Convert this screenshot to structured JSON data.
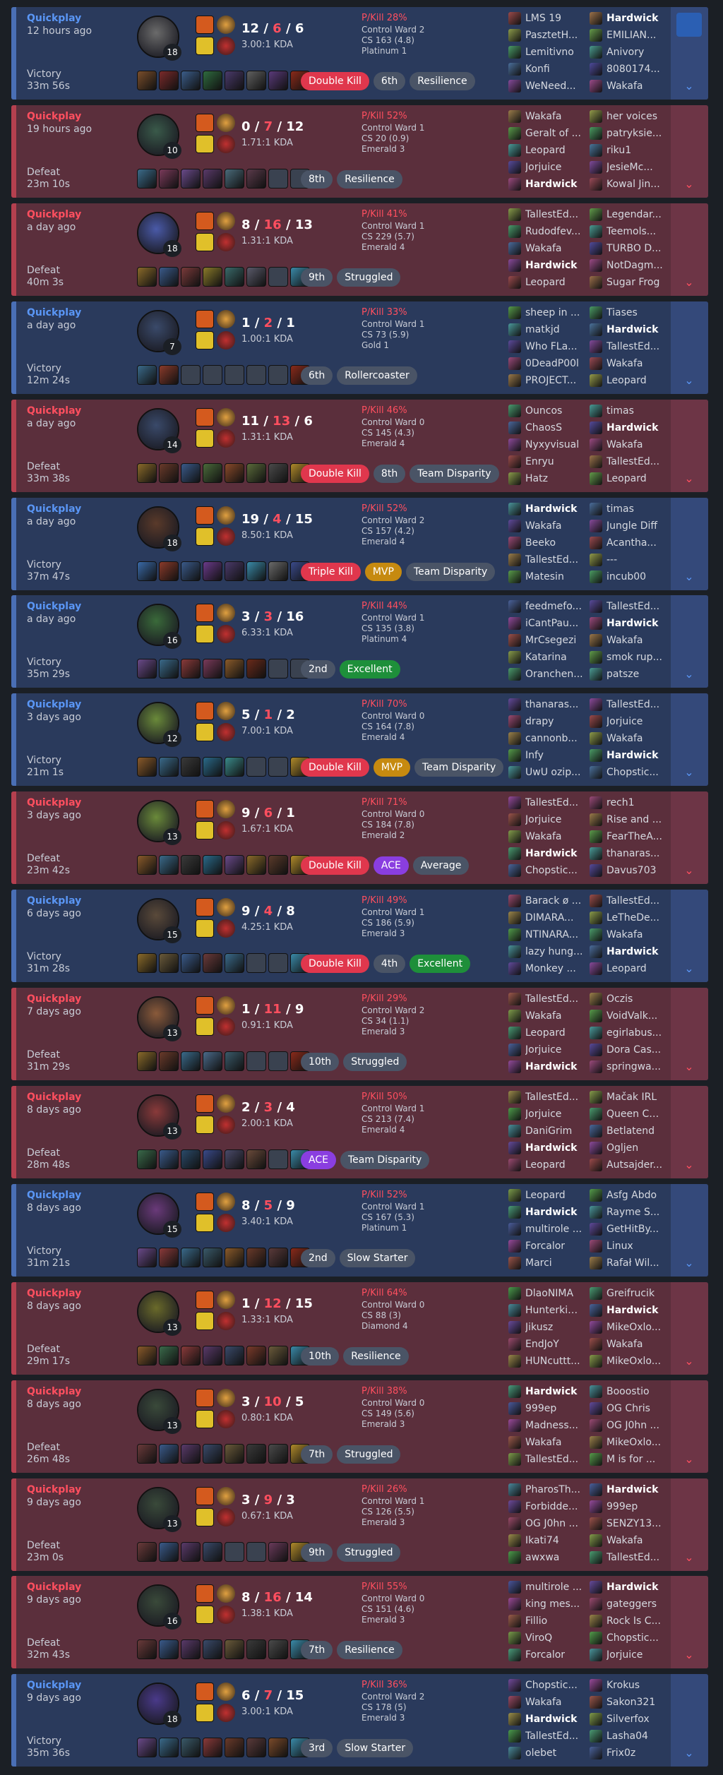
{
  "matches": [
    {
      "result_class": "win",
      "mode": "Quickplay",
      "ago": "12 hours ago",
      "result": "Victory",
      "duration": "33m 56s",
      "level": "18",
      "k": "12",
      "d": "6",
      "a": "6",
      "kda": "3.00:1 KDA",
      "pkill": "P/Kill 28%",
      "ward": "Control Ward 2",
      "cs": "CS 163 (4.8)",
      "rank": "Platinum 1",
      "badges": [
        {
          "t": "Double Kill",
          "c": "b-red"
        },
        {
          "t": "6th",
          "c": "b-gray"
        },
        {
          "t": "Resilience",
          "c": "b-gray"
        }
      ],
      "team1": [
        "LMS 19",
        "PasztetH...",
        "Lemitivno",
        "Konfi",
        "WeNeed..."
      ],
      "team2": [
        "Hardwick",
        "EMILIAN...",
        "Anivory",
        "8080174...",
        "Wakafa"
      ],
      "me_team": 2,
      "me_idx": 0,
      "champ_color": "#6b6b6b",
      "items": [
        "#7a4e2b",
        "#7a2a2a",
        "#3b5d8a",
        "#2f6b3f",
        "#4a3a6b",
        "#606060",
        "#5a3a7a",
        "#8a2a1a"
      ],
      "video": true
    },
    {
      "result_class": "loss",
      "mode": "Quickplay",
      "ago": "19 hours ago",
      "result": "Defeat",
      "duration": "23m 10s",
      "level": "10",
      "k": "0",
      "d": "7",
      "a": "12",
      "kda": "1.71:1 KDA",
      "pkill": "P/Kill 52%",
      "ward": "Control Ward 1",
      "cs": "CS 20 (0.9)",
      "rank": "Emerald 3",
      "badges": [
        {
          "t": "8th",
          "c": "b-gray"
        },
        {
          "t": "Resilience",
          "c": "b-gray"
        }
      ],
      "team1": [
        "Wakafa",
        "Geralt of ...",
        "Leopard",
        "Jorjuice",
        "Hardwick"
      ],
      "team2": [
        "her voices",
        "patryksie...",
        "riku1",
        "JesieMc...",
        "Kowal Jin..."
      ],
      "me_team": 1,
      "me_idx": 4,
      "champ_color": "#3a5a4a",
      "items": [
        "#3b6b8a",
        "#7a3a5a",
        "#6a4a8a",
        "#5a3a6a",
        "#4a6b7a",
        "#5a3a4a",
        "",
        ""
      ]
    },
    {
      "result_class": "loss",
      "mode": "Quickplay",
      "ago": "a day ago",
      "result": "Defeat",
      "duration": "40m 3s",
      "level": "18",
      "k": "8",
      "d": "16",
      "a": "13",
      "kda": "1.31:1 KDA",
      "pkill": "P/Kill 41%",
      "ward": "Control Ward 1",
      "cs": "CS 229 (5.7)",
      "rank": "Emerald 4",
      "badges": [
        {
          "t": "9th",
          "c": "b-gray"
        },
        {
          "t": "Struggled",
          "c": "b-gray"
        }
      ],
      "team1": [
        "TallestEd...",
        "Rudodfev...",
        "Wakafa",
        "Hardwick",
        "Leopard"
      ],
      "team2": [
        "Legendar...",
        "Teemols...",
        "TURBO D...",
        "NotDagm...",
        "Sugar Frog"
      ],
      "me_team": 1,
      "me_idx": 3,
      "champ_color": "#4a5aa8",
      "items": [
        "#8a6a2a",
        "#3a5a8a",
        "#7a3a3a",
        "#8a7a2a",
        "#3a6a6a",
        "#5a5a6a",
        "",
        "#3a8aa8"
      ]
    },
    {
      "result_class": "win",
      "mode": "Quickplay",
      "ago": "a day ago",
      "result": "Victory",
      "duration": "12m 24s",
      "level": "7",
      "k": "1",
      "d": "2",
      "a": "1",
      "kda": "1.00:1 KDA",
      "pkill": "P/Kill 33%",
      "ward": "Control Ward 1",
      "cs": "CS 73 (5.9)",
      "rank": "Gold 1",
      "badges": [
        {
          "t": "6th",
          "c": "b-gray"
        },
        {
          "t": "Rollercoaster",
          "c": "b-gray"
        }
      ],
      "team1": [
        "sheep in ...",
        "matkjd",
        "Who FLa...",
        "0DeadP00l",
        "PROJECT..."
      ],
      "team2": [
        "Tiases",
        "Hardwick",
        "TallestEd...",
        "Wakafa",
        "Leopard"
      ],
      "me_team": 2,
      "me_idx": 1,
      "champ_color": "#3a4a6a",
      "items": [
        "#3a6a8a",
        "#8a3a2a",
        "",
        "",
        "",
        "",
        "",
        "#8a2a1a"
      ]
    },
    {
      "result_class": "loss",
      "mode": "Quickplay",
      "ago": "a day ago",
      "result": "Defeat",
      "duration": "33m 38s",
      "level": "14",
      "k": "11",
      "d": "13",
      "a": "6",
      "kda": "1.31:1 KDA",
      "pkill": "P/Kill 46%",
      "ward": "Control Ward 0",
      "cs": "CS 145 (4.3)",
      "rank": "Emerald 4",
      "badges": [
        {
          "t": "Double Kill",
          "c": "b-red"
        },
        {
          "t": "8th",
          "c": "b-gray"
        },
        {
          "t": "Team Disparity",
          "c": "b-gray"
        }
      ],
      "team1": [
        "Ouncos",
        "ChaosS",
        "Nyxyvisual",
        "Enryu",
        "Hatz"
      ],
      "team2": [
        "timas",
        "Hardwick",
        "Wakafa",
        "TallestEd...",
        "Leopard"
      ],
      "me_team": 2,
      "me_idx": 1,
      "champ_color": "#3a4a6a",
      "items": [
        "#8a6a2a",
        "#6a3a2a",
        "#3a5a8a",
        "#4a6a3a",
        "#8a4a2a",
        "#5a6a3a",
        "#4a4a4a",
        "#b08a2a"
      ]
    },
    {
      "result_class": "win",
      "mode": "Quickplay",
      "ago": "a day ago",
      "result": "Victory",
      "duration": "37m 47s",
      "level": "18",
      "k": "19",
      "d": "4",
      "a": "15",
      "kda": "8.50:1 KDA",
      "pkill": "P/Kill 52%",
      "ward": "Control Ward 2",
      "cs": "CS 157 (4.2)",
      "rank": "Emerald 4",
      "badges": [
        {
          "t": "Triple Kill",
          "c": "b-red"
        },
        {
          "t": "MVP",
          "c": "b-gold"
        },
        {
          "t": "Team Disparity",
          "c": "b-gray"
        }
      ],
      "team1": [
        "Hardwick",
        "Wakafa",
        "Beeko",
        "TallestEd...",
        "Matesin"
      ],
      "team2": [
        "timas",
        "Jungle Diff",
        "Acantha...",
        "---",
        "incub00"
      ],
      "me_team": 1,
      "me_idx": 0,
      "champ_color": "#5a3a2a",
      "items": [
        "#3a6aa8",
        "#8a3a2a",
        "#3a5a8a",
        "#6a3a8a",
        "#4a3a6a",
        "#3a8aa8",
        "#6a6a6a",
        "#3a4a8a"
      ]
    },
    {
      "result_class": "win",
      "mode": "Quickplay",
      "ago": "a day ago",
      "result": "Victory",
      "duration": "35m 29s",
      "level": "16",
      "k": "3",
      "d": "3",
      "a": "16",
      "kda": "6.33:1 KDA",
      "pkill": "P/Kill 44%",
      "ward": "Control Ward 1",
      "cs": "CS 135 (3.8)",
      "rank": "Platinum 4",
      "badges": [
        {
          "t": "2nd",
          "c": "b-gray"
        },
        {
          "t": "Excellent",
          "c": "b-green"
        }
      ],
      "team1": [
        "feedmefo...",
        "iCantPau...",
        "MrCsegezi",
        "Katarina",
        "Oranchen..."
      ],
      "team2": [
        "TallestEd...",
        "Hardwick",
        "Wakafa",
        "smok rup...",
        "patsze"
      ],
      "me_team": 2,
      "me_idx": 1,
      "champ_color": "#3a6a3a",
      "items": [
        "#6a4a8a",
        "#3a6a8a",
        "#8a3a3a",
        "#7a3a5a",
        "#8a5a2a",
        "#6a2a1a",
        "",
        ""
      ]
    },
    {
      "result_class": "win",
      "mode": "Quickplay",
      "ago": "3 days ago",
      "result": "Victory",
      "duration": "21m 1s",
      "level": "12",
      "k": "5",
      "d": "1",
      "a": "2",
      "kda": "7.00:1 KDA",
      "pkill": "P/Kill 70%",
      "ward": "Control Ward 0",
      "cs": "CS 164 (7.8)",
      "rank": "Emerald 4",
      "badges": [
        {
          "t": "Double Kill",
          "c": "b-red"
        },
        {
          "t": "MVP",
          "c": "b-gold"
        },
        {
          "t": "Team Disparity",
          "c": "b-gray"
        }
      ],
      "team1": [
        "thanaras...",
        "drapy",
        "cannonb...",
        "Infy",
        "UwU ozip..."
      ],
      "team2": [
        "TallestEd...",
        "Jorjuice",
        "Wakafa",
        "Hardwick",
        "Chopstic..."
      ],
      "me_team": 2,
      "me_idx": 3,
      "champ_color": "#6a8a3a",
      "items": [
        "#8a5a2a",
        "#3a6a8a",
        "#3a3a3a",
        "#2a6a8a",
        "#3a8a8a",
        "",
        "",
        "#b08a2a"
      ]
    },
    {
      "result_class": "loss",
      "mode": "Quickplay",
      "ago": "3 days ago",
      "result": "Defeat",
      "duration": "23m 42s",
      "level": "13",
      "k": "9",
      "d": "6",
      "a": "1",
      "kda": "1.67:1 KDA",
      "pkill": "P/Kill 71%",
      "ward": "Control Ward 0",
      "cs": "CS 184 (7.8)",
      "rank": "Emerald 2",
      "badges": [
        {
          "t": "Double Kill",
          "c": "b-red"
        },
        {
          "t": "ACE",
          "c": "b-purple"
        },
        {
          "t": "Average",
          "c": "b-gray"
        }
      ],
      "team1": [
        "TallestEd...",
        "Jorjuice",
        "Wakafa",
        "Hardwick",
        "Chopstic..."
      ],
      "team2": [
        "rech1",
        "Rise and ...",
        "FearTheA...",
        "thanaras...",
        "Davus703"
      ],
      "me_team": 1,
      "me_idx": 3,
      "champ_color": "#6a8a3a",
      "items": [
        "#8a5a2a",
        "#3a6a8a",
        "#3a3a3a",
        "#2a6a8a",
        "#6a4a8a",
        "#8a6a2a",
        "#5a3a2a",
        "#b08a2a"
      ]
    },
    {
      "result_class": "win",
      "mode": "Quickplay",
      "ago": "6 days ago",
      "result": "Victory",
      "duration": "31m 28s",
      "level": "15",
      "k": "9",
      "d": "4",
      "a": "8",
      "kda": "4.25:1 KDA",
      "pkill": "P/Kill 49%",
      "ward": "Control Ward 1",
      "cs": "CS 186 (5.9)",
      "rank": "Emerald 3",
      "badges": [
        {
          "t": "Double Kill",
          "c": "b-red"
        },
        {
          "t": "4th",
          "c": "b-gray"
        },
        {
          "t": "Excellent",
          "c": "b-green"
        }
      ],
      "team1": [
        "Barack ø ...",
        "DIMARA...",
        "NTINARA...",
        "lazy hung...",
        "Monkey ..."
      ],
      "team2": [
        "TallestEd...",
        "LeTheDe...",
        "Wakafa",
        "Hardwick",
        "Leopard"
      ],
      "me_team": 2,
      "me_idx": 3,
      "champ_color": "#5a4a3a",
      "items": [
        "#8a6a2a",
        "#6a5a3a",
        "#3a5a8a",
        "#6a3a3a",
        "#3a6a8a",
        "",
        "",
        "#3a8aa8"
      ]
    },
    {
      "result_class": "loss",
      "mode": "Quickplay",
      "ago": "7 days ago",
      "result": "Defeat",
      "duration": "31m 29s",
      "level": "13",
      "k": "1",
      "d": "11",
      "a": "9",
      "kda": "0.91:1 KDA",
      "pkill": "P/Kill 29%",
      "ward": "Control Ward 2",
      "cs": "CS 34 (1.1)",
      "rank": "Emerald 3",
      "badges": [
        {
          "t": "10th",
          "c": "b-gray"
        },
        {
          "t": "Struggled",
          "c": "b-gray"
        }
      ],
      "team1": [
        "TallestEd...",
        "Wakafa",
        "Leopard",
        "Jorjuice",
        "Hardwick"
      ],
      "team2": [
        "Oczis",
        "VoidValk...",
        "egirlabus...",
        "Dora Cas...",
        "springwa..."
      ],
      "me_team": 1,
      "me_idx": 4,
      "champ_color": "#8a5a3a",
      "items": [
        "#8a6a2a",
        "#6a3a2a",
        "#3a6a8a",
        "#4a6a8a",
        "#3a5a6a",
        "",
        "",
        "#8a2a1a"
      ]
    },
    {
      "result_class": "loss",
      "mode": "Quickplay",
      "ago": "8 days ago",
      "result": "Defeat",
      "duration": "28m 48s",
      "level": "13",
      "k": "2",
      "d": "3",
      "a": "4",
      "kda": "2.00:1 KDA",
      "pkill": "P/Kill 50%",
      "ward": "Control Ward 1",
      "cs": "CS 213 (7.4)",
      "rank": "Emerald 4",
      "badges": [
        {
          "t": "ACE",
          "c": "b-purple"
        },
        {
          "t": "Team Disparity",
          "c": "b-gray"
        }
      ],
      "team1": [
        "TallestEd...",
        "Jorjuice",
        "DaniGrim",
        "Hardwick",
        "Leopard"
      ],
      "team2": [
        "Mačak IRL",
        "Queen Ca...",
        "Betlatend",
        "Ogljen",
        "Autsajder..."
      ],
      "me_team": 1,
      "me_idx": 3,
      "champ_color": "#8a3a3a",
      "items": [
        "#3a6a4a",
        "#3a5a8a",
        "#2a4a6a",
        "#3a4a8a",
        "#4a4a6a",
        "#6a4a3a",
        "",
        "#3a8aa8"
      ]
    },
    {
      "result_class": "win",
      "mode": "Quickplay",
      "ago": "8 days ago",
      "result": "Victory",
      "duration": "31m 21s",
      "level": "15",
      "k": "8",
      "d": "5",
      "a": "9",
      "kda": "3.40:1 KDA",
      "pkill": "P/Kill 52%",
      "ward": "Control Ward 1",
      "cs": "CS 167 (5.3)",
      "rank": "Platinum 1",
      "badges": [
        {
          "t": "2nd",
          "c": "b-gray"
        },
        {
          "t": "Slow Starter",
          "c": "b-gray"
        }
      ],
      "team1": [
        "Leopard",
        "Hardwick",
        "multirole ...",
        "Forcalor",
        "Marci"
      ],
      "team2": [
        "Asfg Abdo",
        "Rayme S...",
        "GetHitBy...",
        "Linux",
        "Rafał Wil..."
      ],
      "me_team": 1,
      "me_idx": 1,
      "champ_color": "#6a3a7a",
      "items": [
        "#6a4a8a",
        "#8a3a3a",
        "#3a6a8a",
        "#3a5a6a",
        "#8a5a2a",
        "#6a3a2a",
        "#5a3a3a",
        "#8a2a1a"
      ]
    },
    {
      "result_class": "loss",
      "mode": "Quickplay",
      "ago": "8 days ago",
      "result": "Defeat",
      "duration": "29m 17s",
      "level": "13",
      "k": "1",
      "d": "12",
      "a": "15",
      "kda": "1.33:1 KDA",
      "pkill": "P/Kill 64%",
      "ward": "Control Ward 0",
      "cs": "CS 88 (3)",
      "rank": "Diamond 4",
      "badges": [
        {
          "t": "10th",
          "c": "b-gray"
        },
        {
          "t": "Resilience",
          "c": "b-gray"
        }
      ],
      "team1": [
        "DlaoNIMA",
        "Hunterkin...",
        "Jikusz",
        "EndJoY",
        "HUNcuttt..."
      ],
      "team2": [
        "Greifrucik",
        "Hardwick",
        "MikeOxlo...",
        "Wakafa",
        "MikeOxlo..."
      ],
      "me_team": 2,
      "me_idx": 1,
      "champ_color": "#6a6a2a",
      "items": [
        "#8a5a2a",
        "#3a6a4a",
        "#8a3a3a",
        "#5a3a6a",
        "#3a4a6a",
        "#7a3a2a",
        "#6a5a3a",
        "#3a8aa8"
      ]
    },
    {
      "result_class": "loss",
      "mode": "Quickplay",
      "ago": "8 days ago",
      "result": "Defeat",
      "duration": "26m 48s",
      "level": "13",
      "k": "3",
      "d": "10",
      "a": "5",
      "kda": "0.80:1 KDA",
      "pkill": "P/Kill 38%",
      "ward": "Control Ward 0",
      "cs": "CS 149 (5.6)",
      "rank": "Emerald 3",
      "badges": [
        {
          "t": "7th",
          "c": "b-gray"
        },
        {
          "t": "Struggled",
          "c": "b-gray"
        }
      ],
      "team1": [
        "Hardwick",
        "999ep",
        "Madness...",
        "Wakafa",
        "TallestEd..."
      ],
      "team2": [
        "Booostio",
        "OG Chris",
        "OG J0hn ...",
        "MikeOxlo...",
        "M is for ..."
      ],
      "me_team": 1,
      "me_idx": 0,
      "champ_color": "#3a4a3a",
      "items": [
        "#6a3a3a",
        "#3a5a8a",
        "#5a3a6a",
        "#3a4a6a",
        "#6a5a3a",
        "#3a3a3a",
        "#4a4a4a",
        "#b08a2a"
      ]
    },
    {
      "result_class": "loss",
      "mode": "Quickplay",
      "ago": "9 days ago",
      "result": "Defeat",
      "duration": "23m 0s",
      "level": "13",
      "k": "3",
      "d": "9",
      "a": "3",
      "kda": "0.67:1 KDA",
      "pkill": "P/Kill 26%",
      "ward": "Control Ward 1",
      "cs": "CS 126 (5.5)",
      "rank": "Emerald 3",
      "badges": [
        {
          "t": "9th",
          "c": "b-gray"
        },
        {
          "t": "Struggled",
          "c": "b-gray"
        }
      ],
      "team1": [
        "PharosTh...",
        "Forbidde...",
        "OG J0hn ...",
        "Ikati74",
        "awxwa"
      ],
      "team2": [
        "Hardwick",
        "999ep",
        "SENZY13...",
        "Wakafa",
        "TallestEd..."
      ],
      "me_team": 2,
      "me_idx": 0,
      "champ_color": "#3a4a3a",
      "items": [
        "#6a3a3a",
        "#3a5a8a",
        "#5a3a6a",
        "#3a4a6a",
        "",
        "",
        "#6a3a5a",
        "#b08a2a"
      ]
    },
    {
      "result_class": "loss",
      "mode": "Quickplay",
      "ago": "9 days ago",
      "result": "Defeat",
      "duration": "32m 43s",
      "level": "16",
      "k": "8",
      "d": "16",
      "a": "14",
      "kda": "1.38:1 KDA",
      "pkill": "P/Kill 55%",
      "ward": "Control Ward 0",
      "cs": "CS 151 (4.6)",
      "rank": "Emerald 3",
      "badges": [
        {
          "t": "7th",
          "c": "b-gray"
        },
        {
          "t": "Resilience",
          "c": "b-gray"
        }
      ],
      "team1": [
        "multirole ...",
        "king mes...",
        "Fillio",
        "ViroQ",
        "Forcalor"
      ],
      "team2": [
        "Hardwick",
        "gateggers",
        "Rock Is C...",
        "Chopstic...",
        "Jorjuice"
      ],
      "me_team": 2,
      "me_idx": 0,
      "champ_color": "#3a4a3a",
      "items": [
        "#6a3a3a",
        "#3a5a8a",
        "#5a3a6a",
        "#3a4a6a",
        "#6a5a3a",
        "#3a3a3a",
        "#4a4a4a",
        "#3a8aa8"
      ]
    },
    {
      "result_class": "win",
      "mode": "Quickplay",
      "ago": "9 days ago",
      "result": "Victory",
      "duration": "35m 36s",
      "level": "18",
      "k": "6",
      "d": "7",
      "a": "15",
      "kda": "3.00:1 KDA",
      "pkill": "P/Kill 36%",
      "ward": "Control Ward 2",
      "cs": "CS 178 (5)",
      "rank": "Emerald 3",
      "badges": [
        {
          "t": "3rd",
          "c": "b-gray"
        },
        {
          "t": "Slow Starter",
          "c": "b-gray"
        }
      ],
      "team1": [
        "Chopstic...",
        "Wakafa",
        "Hardwick",
        "TallestEd...",
        "olebet"
      ],
      "team2": [
        "Krokus",
        "Sakon321",
        "Silverfox",
        "Lasha04",
        "Frix0z"
      ],
      "me_team": 1,
      "me_idx": 2,
      "champ_color": "#4a3a8a",
      "items": [
        "#6a4a8a",
        "#3a6a8a",
        "#3a5a6a",
        "#8a3a3a",
        "#6a3a2a",
        "#5a3a3a",
        "#7a4a2a",
        "#3a8aa8"
      ]
    }
  ]
}
